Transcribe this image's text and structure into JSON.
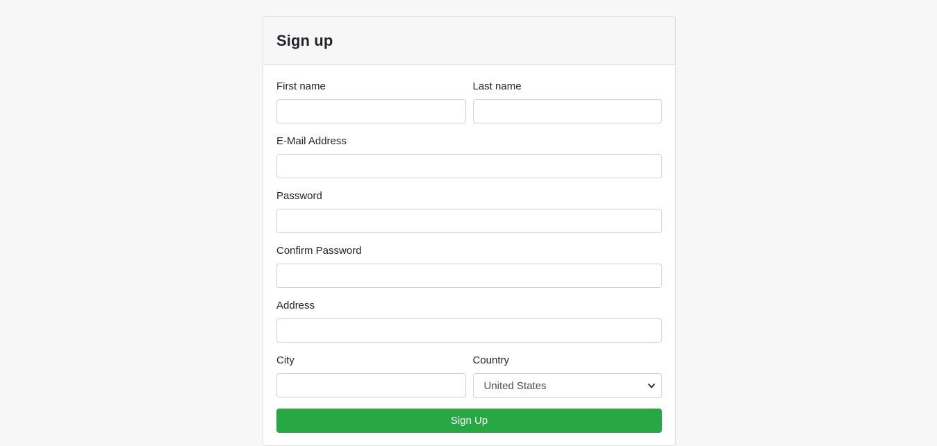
{
  "form": {
    "title": "Sign up",
    "first_name": {
      "label": "First name",
      "value": ""
    },
    "last_name": {
      "label": "Last name",
      "value": ""
    },
    "email": {
      "label": "E-Mail Address",
      "value": ""
    },
    "password": {
      "label": "Password",
      "value": ""
    },
    "confirm_password": {
      "label": "Confirm Password",
      "value": ""
    },
    "address": {
      "label": "Address",
      "value": ""
    },
    "city": {
      "label": "City",
      "value": ""
    },
    "country": {
      "label": "Country",
      "selected": "United States"
    },
    "submit_label": "Sign Up"
  },
  "colors": {
    "page_background": "#f7f7f7",
    "card_header": "#f7f7f7",
    "button": "#28a745",
    "border": "#ced4da"
  },
  "icons": {
    "country_select": "chevron-down-icon"
  }
}
